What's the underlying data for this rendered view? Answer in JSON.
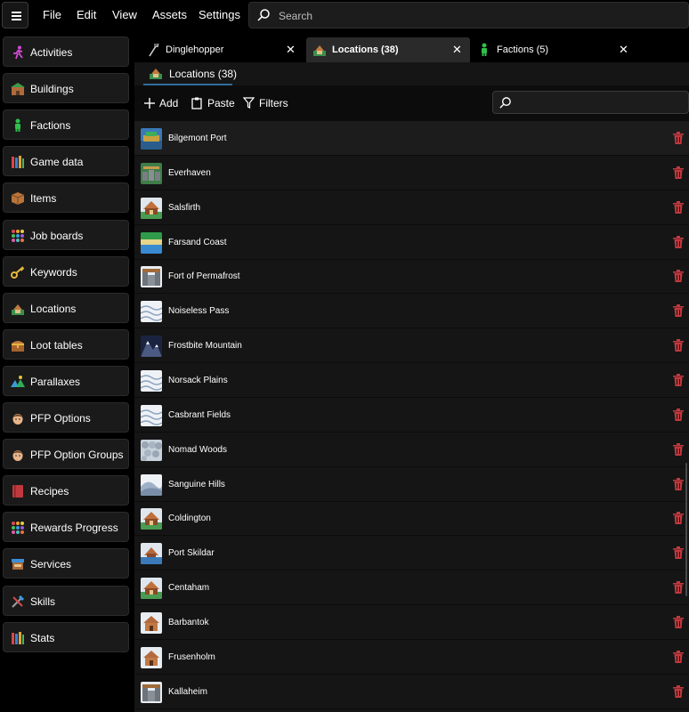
{
  "menu": {
    "items": [
      "File",
      "Edit",
      "View",
      "Assets",
      "Settings"
    ],
    "search_placeholder": "Search"
  },
  "sidebar": {
    "items": [
      {
        "label": "Activities",
        "icon": "running-figure-icon"
      },
      {
        "label": "Buildings",
        "icon": "building-icon"
      },
      {
        "label": "Factions",
        "icon": "person-icon"
      },
      {
        "label": "Game data",
        "icon": "books-icon"
      },
      {
        "label": "Items",
        "icon": "crate-icon"
      },
      {
        "label": "Job boards",
        "icon": "dot-grid-icon"
      },
      {
        "label": "Keywords",
        "icon": "key-icon"
      },
      {
        "label": "Locations",
        "icon": "location-icon"
      },
      {
        "label": "Loot tables",
        "icon": "treasure-chest-icon"
      },
      {
        "label": "Parallaxes",
        "icon": "parallax-icon"
      },
      {
        "label": "PFP Options",
        "icon": "face-icon"
      },
      {
        "label": "PFP Option Groups",
        "icon": "face-icon"
      },
      {
        "label": "Recipes",
        "icon": "recipe-book-icon"
      },
      {
        "label": "Rewards Progress",
        "icon": "dot-grid-icon"
      },
      {
        "label": "Services",
        "icon": "shop-stall-icon"
      },
      {
        "label": "Skills",
        "icon": "tools-icon"
      },
      {
        "label": "Stats",
        "icon": "books-icon"
      }
    ]
  },
  "tabs": [
    {
      "label": "Dinglehopper",
      "icon": "fork-icon",
      "close": "✕"
    },
    {
      "label": "Locations (38)",
      "icon": "location-icon",
      "close": "✕"
    },
    {
      "label": "Factions (5)",
      "icon": "person-icon",
      "close": "✕"
    }
  ],
  "subtab": {
    "label": "Locations (38)"
  },
  "toolbar": {
    "add_label": "Add",
    "paste_label": "Paste",
    "filters_label": "Filters"
  },
  "locations": [
    {
      "name": "Bilgemont Port",
      "thumb": "port"
    },
    {
      "name": "Everhaven",
      "thumb": "village"
    },
    {
      "name": "Salsfirth",
      "thumb": "town"
    },
    {
      "name": "Farsand Coast",
      "thumb": "coast"
    },
    {
      "name": "Fort of Permafrost",
      "thumb": "fort"
    },
    {
      "name": "Noiseless Pass",
      "thumb": "snow"
    },
    {
      "name": "Frostbite Mountain",
      "thumb": "mountain"
    },
    {
      "name": "Norsack Plains",
      "thumb": "snow"
    },
    {
      "name": "Casbrant Fields",
      "thumb": "snow"
    },
    {
      "name": "Nomad Woods",
      "thumb": "woods"
    },
    {
      "name": "Sanguine Hills",
      "thumb": "hills"
    },
    {
      "name": "Coldington",
      "thumb": "town"
    },
    {
      "name": "Port Skildar",
      "thumb": "port-snow"
    },
    {
      "name": "Centaham",
      "thumb": "town"
    },
    {
      "name": "Barbantok",
      "thumb": "house"
    },
    {
      "name": "Frusenholm",
      "thumb": "house"
    },
    {
      "name": "Kallaheim",
      "thumb": "fort"
    }
  ],
  "colors": {
    "accent": "#2f6e9e",
    "trash": "#c0393f"
  }
}
